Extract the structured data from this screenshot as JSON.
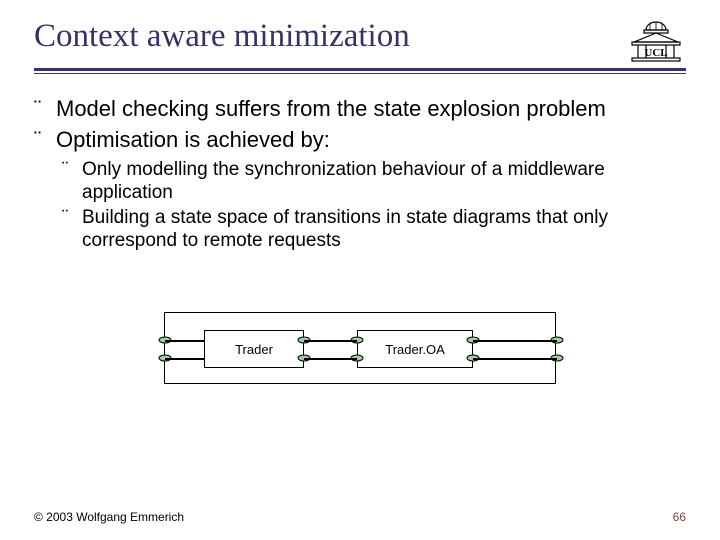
{
  "title": "Context aware minimization",
  "bullet_marker": "¨",
  "bullets": {
    "b1": "Model checking suffers from the state explosion problem",
    "b2": "Optimisation is achieved by:",
    "s1": "Only modelling the synchronization behaviour of a middleware application",
    "s2": "Building a state space of transitions in state diagrams that only correspond to remote requests"
  },
  "diagram": {
    "box1": "Trader",
    "box2": "Trader.OA"
  },
  "footer": {
    "copyright": "© 2003 Wolfgang Emmerich",
    "page": "66"
  },
  "logo_text": "UCL"
}
